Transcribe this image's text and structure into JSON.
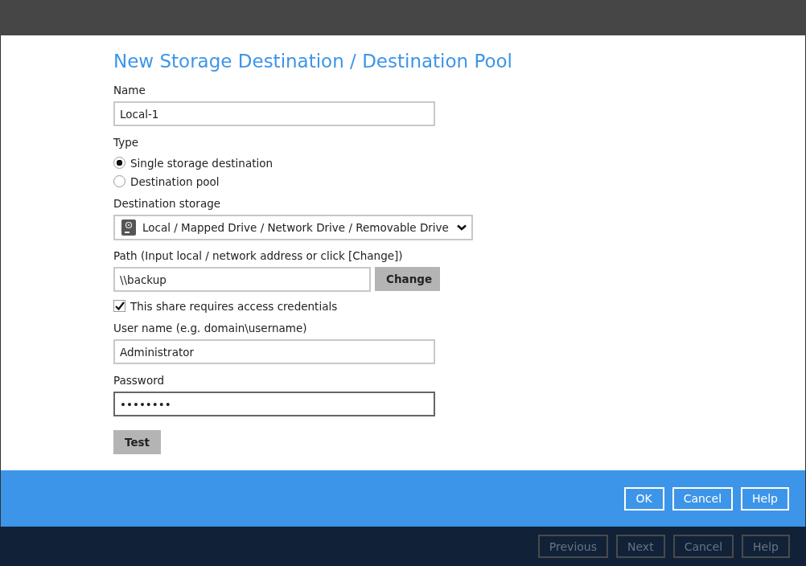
{
  "title": "New Storage Destination / Destination Pool",
  "name_field": {
    "label": "Name",
    "value": "Local-1"
  },
  "type": {
    "label": "Type",
    "options": [
      {
        "label": "Single storage destination",
        "selected": true
      },
      {
        "label": "Destination pool",
        "selected": false
      }
    ]
  },
  "destination_storage": {
    "label": "Destination storage",
    "value": "Local / Mapped Drive / Network Drive / Removable Drive"
  },
  "path": {
    "label": "Path (Input local / network address or click [Change])",
    "value": "\\\\backup",
    "button": "Change"
  },
  "credentials": {
    "label": "This share requires access credentials",
    "checked": true
  },
  "user_name": {
    "label": "User name (e.g. domain\\username)",
    "value": "Administrator"
  },
  "password": {
    "label": "Password",
    "value": "••••••••"
  },
  "test_button": "Test",
  "dialog_buttons": [
    "OK",
    "Cancel",
    "Help"
  ],
  "background_buttons": [
    "Previous",
    "Next",
    "Cancel",
    "Help"
  ]
}
